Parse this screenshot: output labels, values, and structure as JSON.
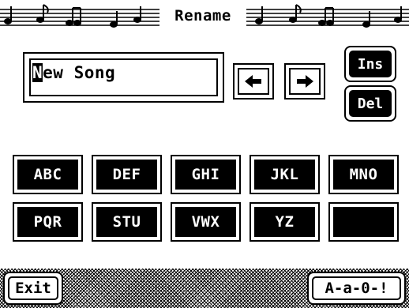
{
  "title": "Rename",
  "name_field": {
    "cursor_char": "N",
    "rest_text": "ew Song"
  },
  "arrows": {
    "left_icon": "arrow-left-icon",
    "right_icon": "arrow-right-icon"
  },
  "edit_buttons": {
    "ins_label": "Ins",
    "del_label": "Del"
  },
  "keys": [
    {
      "label": "ABC"
    },
    {
      "label": "DEF"
    },
    {
      "label": "GHI"
    },
    {
      "label": "JKL"
    },
    {
      "label": "MNO"
    },
    {
      "label": "PQR"
    },
    {
      "label": "STU"
    },
    {
      "label": "VWX"
    },
    {
      "label": "YZ"
    },
    {
      "label": ""
    }
  ],
  "footer": {
    "exit_label": "Exit",
    "mode_label": "A-a-0-!"
  }
}
